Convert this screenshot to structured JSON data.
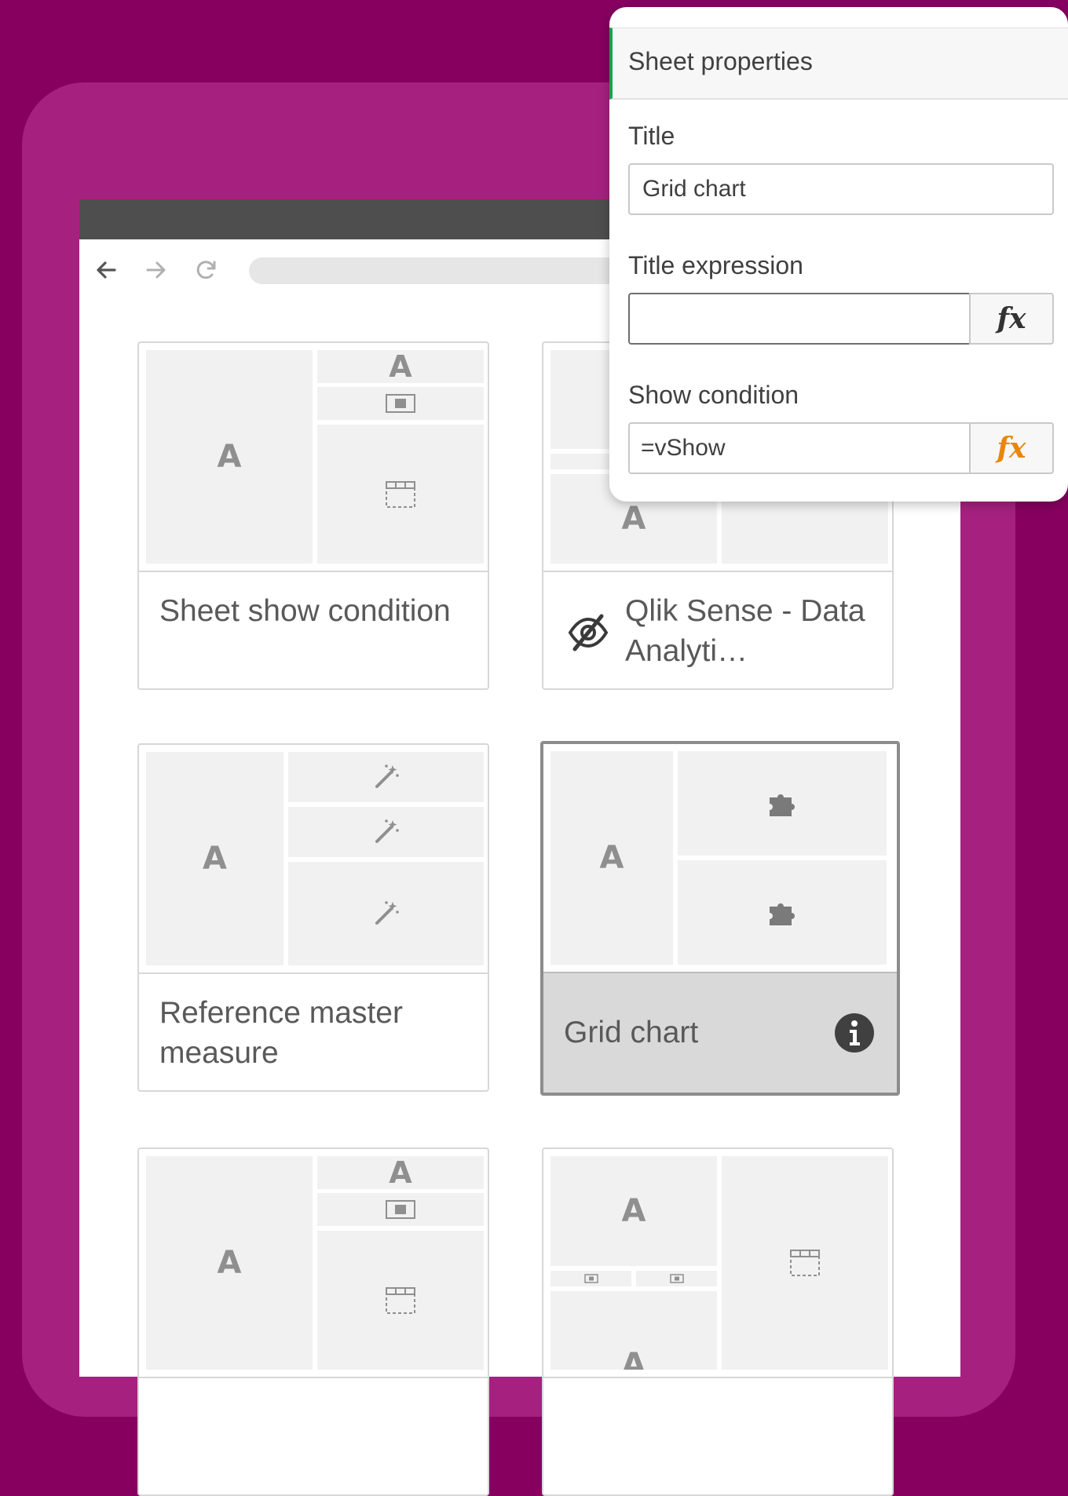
{
  "colors": {
    "background": "#870060",
    "frame": "#a6217f",
    "browser_bar": "#4e4e4e",
    "accent_green": "#16a34a",
    "fx_active": "#e8870c",
    "fx_inactive": "#333333"
  },
  "browser": {
    "nav": [
      {
        "icon": "back-arrow-icon"
      },
      {
        "icon": "forward-arrow-icon"
      },
      {
        "icon": "reload-icon"
      }
    ]
  },
  "sheets": [
    {
      "title": "Sheet show condition",
      "hidden": false,
      "selected": false
    },
    {
      "title": "Qlik Sense - Data Analyti…",
      "hidden": true,
      "hidden_icon": "eye-slash-icon",
      "selected": false
    },
    {
      "title": "Reference master measure",
      "hidden": false,
      "selected": false
    },
    {
      "title": "Grid chart",
      "hidden": false,
      "selected": true,
      "info_icon": "info-icon"
    },
    {
      "title": "",
      "hidden": false,
      "selected": false
    },
    {
      "title": "",
      "hidden": false,
      "selected": false
    }
  ],
  "thumb_glyph": "A",
  "panel": {
    "header": "Sheet properties",
    "title_label": "Title",
    "title_value": "Grid chart",
    "title_expr_label": "Title expression",
    "title_expr_value": "",
    "show_condition_label": "Show condition",
    "show_condition_value": "=vShow",
    "fx_label": "fx"
  }
}
